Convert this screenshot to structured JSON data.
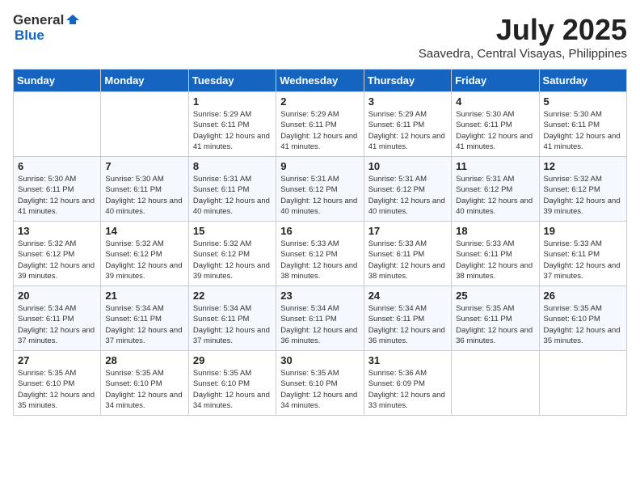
{
  "logo": {
    "text_general": "General",
    "text_blue": "Blue"
  },
  "title": {
    "month_year": "July 2025",
    "location": "Saavedra, Central Visayas, Philippines"
  },
  "weekdays": [
    "Sunday",
    "Monday",
    "Tuesday",
    "Wednesday",
    "Thursday",
    "Friday",
    "Saturday"
  ],
  "weeks": [
    [
      {
        "day": "",
        "info": ""
      },
      {
        "day": "",
        "info": ""
      },
      {
        "day": "1",
        "info": "Sunrise: 5:29 AM\nSunset: 6:11 PM\nDaylight: 12 hours and 41 minutes."
      },
      {
        "day": "2",
        "info": "Sunrise: 5:29 AM\nSunset: 6:11 PM\nDaylight: 12 hours and 41 minutes."
      },
      {
        "day": "3",
        "info": "Sunrise: 5:29 AM\nSunset: 6:11 PM\nDaylight: 12 hours and 41 minutes."
      },
      {
        "day": "4",
        "info": "Sunrise: 5:30 AM\nSunset: 6:11 PM\nDaylight: 12 hours and 41 minutes."
      },
      {
        "day": "5",
        "info": "Sunrise: 5:30 AM\nSunset: 6:11 PM\nDaylight: 12 hours and 41 minutes."
      }
    ],
    [
      {
        "day": "6",
        "info": "Sunrise: 5:30 AM\nSunset: 6:11 PM\nDaylight: 12 hours and 41 minutes."
      },
      {
        "day": "7",
        "info": "Sunrise: 5:30 AM\nSunset: 6:11 PM\nDaylight: 12 hours and 40 minutes."
      },
      {
        "day": "8",
        "info": "Sunrise: 5:31 AM\nSunset: 6:11 PM\nDaylight: 12 hours and 40 minutes."
      },
      {
        "day": "9",
        "info": "Sunrise: 5:31 AM\nSunset: 6:12 PM\nDaylight: 12 hours and 40 minutes."
      },
      {
        "day": "10",
        "info": "Sunrise: 5:31 AM\nSunset: 6:12 PM\nDaylight: 12 hours and 40 minutes."
      },
      {
        "day": "11",
        "info": "Sunrise: 5:31 AM\nSunset: 6:12 PM\nDaylight: 12 hours and 40 minutes."
      },
      {
        "day": "12",
        "info": "Sunrise: 5:32 AM\nSunset: 6:12 PM\nDaylight: 12 hours and 39 minutes."
      }
    ],
    [
      {
        "day": "13",
        "info": "Sunrise: 5:32 AM\nSunset: 6:12 PM\nDaylight: 12 hours and 39 minutes."
      },
      {
        "day": "14",
        "info": "Sunrise: 5:32 AM\nSunset: 6:12 PM\nDaylight: 12 hours and 39 minutes."
      },
      {
        "day": "15",
        "info": "Sunrise: 5:32 AM\nSunset: 6:12 PM\nDaylight: 12 hours and 39 minutes."
      },
      {
        "day": "16",
        "info": "Sunrise: 5:33 AM\nSunset: 6:12 PM\nDaylight: 12 hours and 38 minutes."
      },
      {
        "day": "17",
        "info": "Sunrise: 5:33 AM\nSunset: 6:11 PM\nDaylight: 12 hours and 38 minutes."
      },
      {
        "day": "18",
        "info": "Sunrise: 5:33 AM\nSunset: 6:11 PM\nDaylight: 12 hours and 38 minutes."
      },
      {
        "day": "19",
        "info": "Sunrise: 5:33 AM\nSunset: 6:11 PM\nDaylight: 12 hours and 37 minutes."
      }
    ],
    [
      {
        "day": "20",
        "info": "Sunrise: 5:34 AM\nSunset: 6:11 PM\nDaylight: 12 hours and 37 minutes."
      },
      {
        "day": "21",
        "info": "Sunrise: 5:34 AM\nSunset: 6:11 PM\nDaylight: 12 hours and 37 minutes."
      },
      {
        "day": "22",
        "info": "Sunrise: 5:34 AM\nSunset: 6:11 PM\nDaylight: 12 hours and 37 minutes."
      },
      {
        "day": "23",
        "info": "Sunrise: 5:34 AM\nSunset: 6:11 PM\nDaylight: 12 hours and 36 minutes."
      },
      {
        "day": "24",
        "info": "Sunrise: 5:34 AM\nSunset: 6:11 PM\nDaylight: 12 hours and 36 minutes."
      },
      {
        "day": "25",
        "info": "Sunrise: 5:35 AM\nSunset: 6:11 PM\nDaylight: 12 hours and 36 minutes."
      },
      {
        "day": "26",
        "info": "Sunrise: 5:35 AM\nSunset: 6:10 PM\nDaylight: 12 hours and 35 minutes."
      }
    ],
    [
      {
        "day": "27",
        "info": "Sunrise: 5:35 AM\nSunset: 6:10 PM\nDaylight: 12 hours and 35 minutes."
      },
      {
        "day": "28",
        "info": "Sunrise: 5:35 AM\nSunset: 6:10 PM\nDaylight: 12 hours and 34 minutes."
      },
      {
        "day": "29",
        "info": "Sunrise: 5:35 AM\nSunset: 6:10 PM\nDaylight: 12 hours and 34 minutes."
      },
      {
        "day": "30",
        "info": "Sunrise: 5:35 AM\nSunset: 6:10 PM\nDaylight: 12 hours and 34 minutes."
      },
      {
        "day": "31",
        "info": "Sunrise: 5:36 AM\nSunset: 6:09 PM\nDaylight: 12 hours and 33 minutes."
      },
      {
        "day": "",
        "info": ""
      },
      {
        "day": "",
        "info": ""
      }
    ]
  ]
}
